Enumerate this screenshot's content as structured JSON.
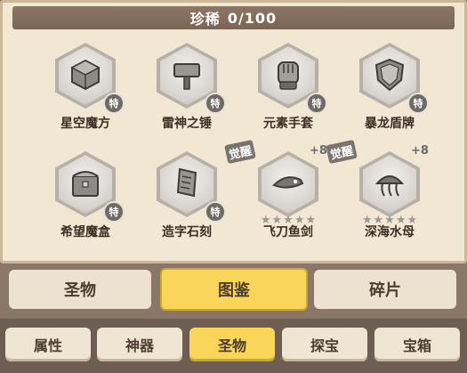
{
  "header": {
    "title_label": "珍稀",
    "progress": "0/100"
  },
  "items": [
    {
      "name": "星空魔方",
      "badge": "特",
      "icon": "cube-icon"
    },
    {
      "name": "雷神之锤",
      "badge": "特",
      "icon": "hammer-icon"
    },
    {
      "name": "元素手套",
      "badge": "特",
      "icon": "glove-icon"
    },
    {
      "name": "暴龙盾牌",
      "badge": "特",
      "icon": "shield-icon"
    },
    {
      "name": "希望魔盒",
      "badge": "特",
      "icon": "box-icon"
    },
    {
      "name": "造字石刻",
      "badge": "特",
      "icon": "stone-tablet-icon"
    },
    {
      "name": "飞刀鱼剑",
      "awaken": "觉醒",
      "plus": "+8",
      "stars": 5,
      "icon": "fish-sword-icon"
    },
    {
      "name": "深海水母",
      "awaken": "觉醒",
      "plus": "+8",
      "stars": 5,
      "icon": "jellyfish-icon"
    }
  ],
  "subtabs": {
    "left": "圣物",
    "center": "图鉴",
    "right": "碎片",
    "active": "图鉴"
  },
  "bottom_tabs": {
    "tab1": "属性",
    "tab2": "神器",
    "tab3": "圣物",
    "tab4": "探宝",
    "tab5": "宝箱",
    "active": "圣物"
  },
  "colors": {
    "accent": "#f9d65a",
    "panel": "#f1e7d2",
    "title_bar": "#7b6556"
  }
}
